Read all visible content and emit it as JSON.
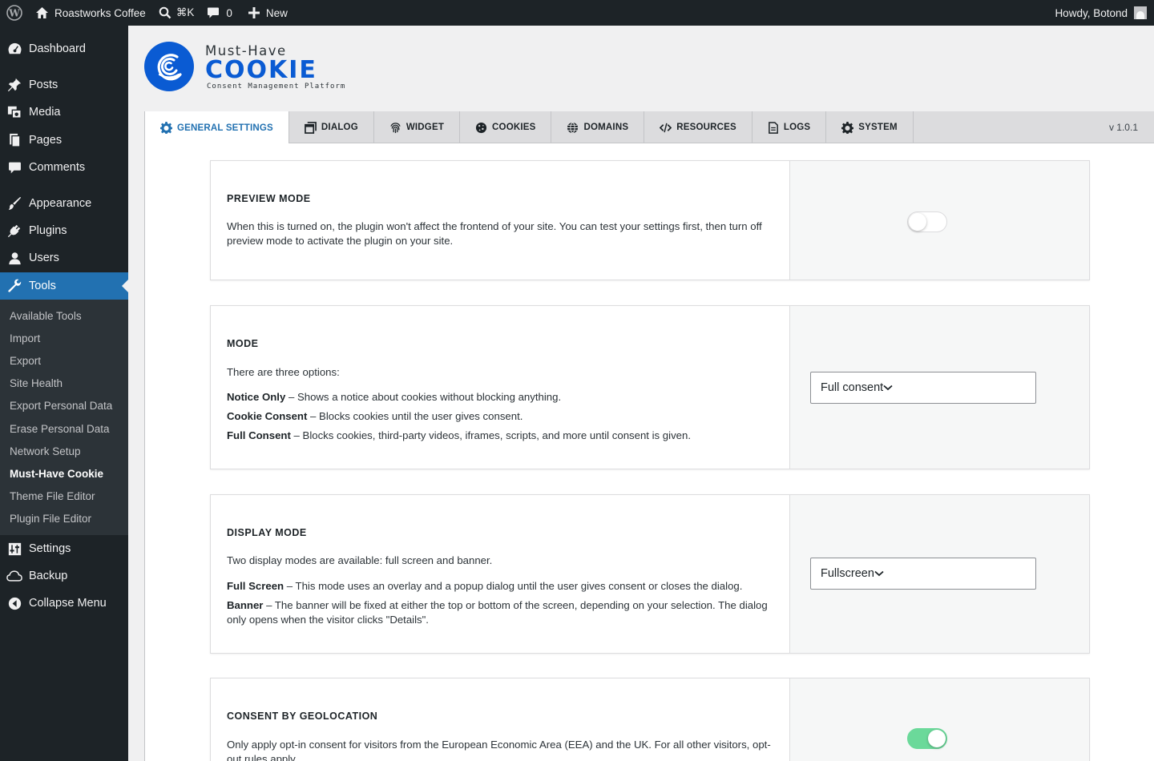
{
  "adminbar": {
    "site_name": "Roastworks Coffee",
    "shortcut": "⌘K",
    "comments_count": "0",
    "new_label": "New",
    "greeting": "Howdy, Botond"
  },
  "sidebar": {
    "items": [
      {
        "label": "Dashboard",
        "icon": "dashboard-icon"
      },
      {
        "label": "Posts",
        "icon": "pin-icon"
      },
      {
        "label": "Media",
        "icon": "media-icon"
      },
      {
        "label": "Pages",
        "icon": "pages-icon"
      },
      {
        "label": "Comments",
        "icon": "comment-icon"
      },
      {
        "label": "Appearance",
        "icon": "brush-icon"
      },
      {
        "label": "Plugins",
        "icon": "plug-icon"
      },
      {
        "label": "Users",
        "icon": "user-icon"
      },
      {
        "label": "Tools",
        "icon": "wrench-icon"
      },
      {
        "label": "Settings",
        "icon": "sliders-icon"
      },
      {
        "label": "Backup",
        "icon": "cloud-icon"
      },
      {
        "label": "Collapse Menu",
        "icon": "collapse-icon"
      }
    ],
    "submenu": [
      "Available Tools",
      "Import",
      "Export",
      "Site Health",
      "Export Personal Data",
      "Erase Personal Data",
      "Network Setup",
      "Must-Have Cookie",
      "Theme File Editor",
      "Plugin File Editor"
    ],
    "active_item": "Tools",
    "current_subitem": "Must-Have Cookie"
  },
  "logo": {
    "top": "Must-Have",
    "main": "COOKIE",
    "sub": "Consent Management Platform",
    "color": "#0a5bd3"
  },
  "tabs": [
    {
      "label": "GENERAL SETTINGS",
      "icon": "gear-icon"
    },
    {
      "label": "DIALOG",
      "icon": "window-icon"
    },
    {
      "label": "WIDGET",
      "icon": "fingerprint-icon"
    },
    {
      "label": "COOKIES",
      "icon": "cookie-icon"
    },
    {
      "label": "DOMAINS",
      "icon": "globe-icon"
    },
    {
      "label": "RESOURCES",
      "icon": "code-icon"
    },
    {
      "label": "LOGS",
      "icon": "document-icon"
    },
    {
      "label": "SYSTEM",
      "icon": "gear-icon"
    }
  ],
  "active_tab": "GENERAL SETTINGS",
  "version": "v 1.0.1",
  "settings": {
    "preview": {
      "title": "PREVIEW MODE",
      "description": "When this is turned on, the plugin won't affect the frontend of your site. You can test your settings first, then turn off preview mode to activate the plugin on your site.",
      "enabled": false
    },
    "mode": {
      "title": "MODE",
      "intro": "There are three options:",
      "options": [
        {
          "term": "Notice Only",
          "text": " – Shows a notice about cookies without blocking anything."
        },
        {
          "term": "Cookie Consent",
          "text": " – Blocks cookies until the user gives consent."
        },
        {
          "term": "Full Consent",
          "text": " – Blocks cookies, third-party videos, iframes, scripts, and more until consent is given."
        }
      ],
      "selected": "Full consent"
    },
    "display": {
      "title": "DISPLAY MODE",
      "intro": "Two display modes are available: full screen and banner.",
      "options": [
        {
          "term": "Full Screen",
          "text": " – This mode uses an overlay and a popup dialog until the user gives consent or closes the dialog."
        },
        {
          "term": "Banner",
          "text": " – The banner will be fixed at either the top or bottom of the screen, depending on your selection. The dialog only opens when the visitor clicks \"Details\"."
        }
      ],
      "selected": "Fullscreen"
    },
    "geolocation": {
      "title": "CONSENT BY GEOLOCATION",
      "description": "Only apply opt-in consent for visitors from the European Economic Area (EEA) and the UK. For all other visitors, opt-out rules apply.",
      "enabled": true
    }
  },
  "colors": {
    "admin_dark": "#1d2327",
    "accent": "#2271b1",
    "toggle_on": "#6bd99a"
  }
}
